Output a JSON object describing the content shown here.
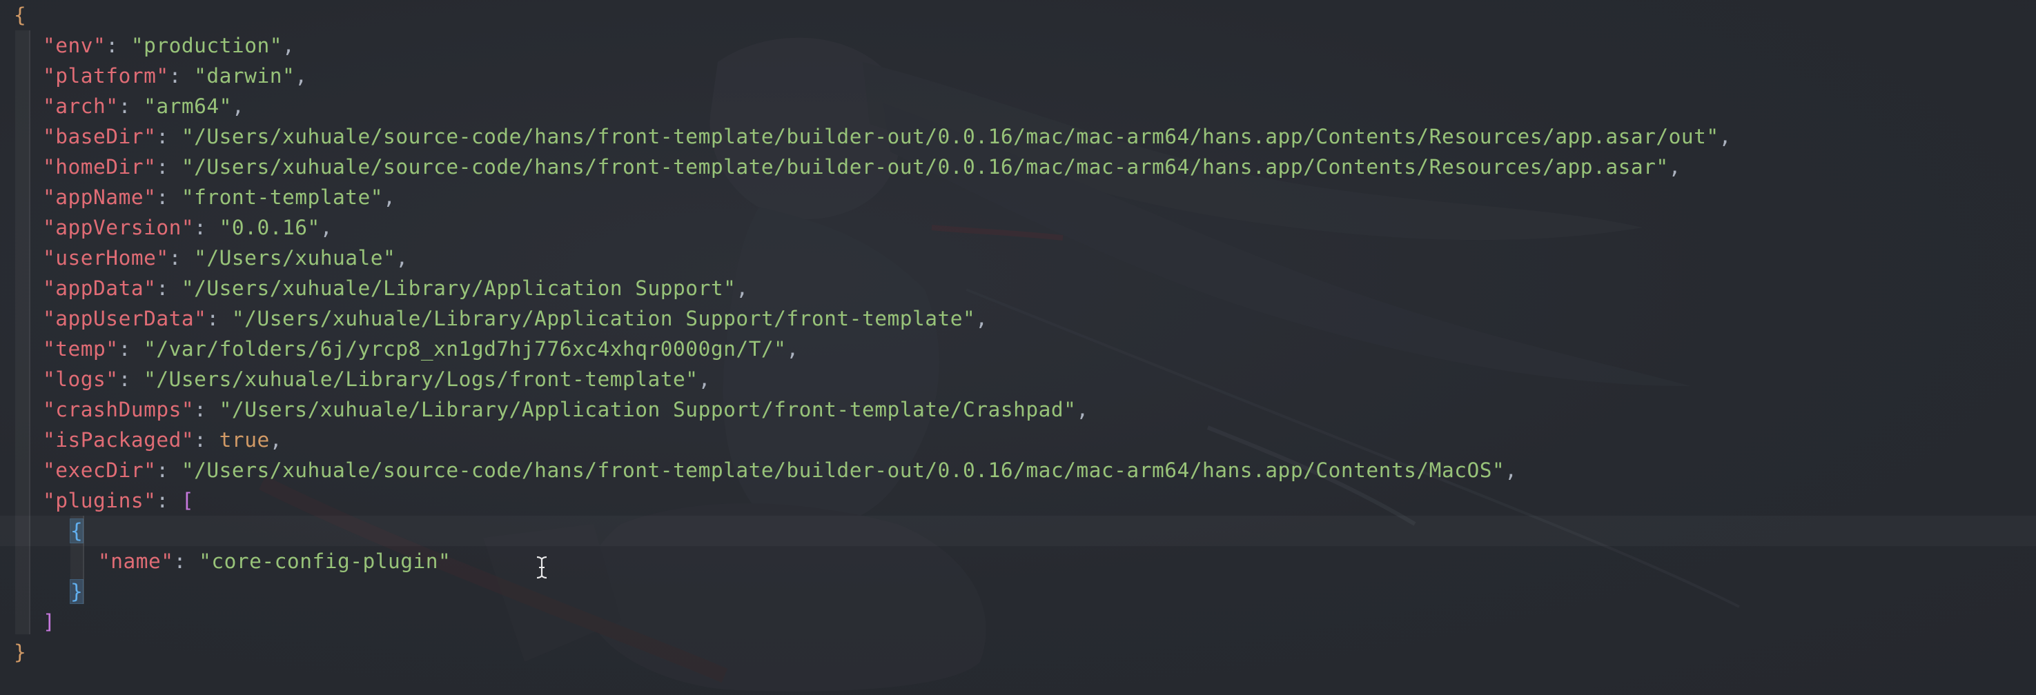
{
  "editor": {
    "open_brace": "{",
    "close_brace": "}",
    "entries": [
      {
        "key": "\"env\"",
        "value": "\"production\"",
        "trail": ","
      },
      {
        "key": "\"platform\"",
        "value": "\"darwin\"",
        "trail": ","
      },
      {
        "key": "\"arch\"",
        "value": "\"arm64\"",
        "trail": ","
      },
      {
        "key": "\"baseDir\"",
        "value": "\"/Users/xuhuale/source-code/hans/front-template/builder-out/0.0.16/mac/mac-arm64/hans.app/Contents/Resources/app.asar/out\"",
        "trail": ","
      },
      {
        "key": "\"homeDir\"",
        "value": "\"/Users/xuhuale/source-code/hans/front-template/builder-out/0.0.16/mac/mac-arm64/hans.app/Contents/Resources/app.asar\"",
        "trail": ","
      },
      {
        "key": "\"appName\"",
        "value": "\"front-template\"",
        "trail": ","
      },
      {
        "key": "\"appVersion\"",
        "value": "\"0.0.16\"",
        "trail": ","
      },
      {
        "key": "\"userHome\"",
        "value": "\"/Users/xuhuale\"",
        "trail": ","
      },
      {
        "key": "\"appData\"",
        "value": "\"/Users/xuhuale/Library/Application Support\"",
        "trail": ","
      },
      {
        "key": "\"appUserData\"",
        "value": "\"/Users/xuhuale/Library/Application Support/front-template\"",
        "trail": ","
      },
      {
        "key": "\"temp\"",
        "value": "\"/var/folders/6j/yrcp8_xn1gd7hj776xc4xhqr0000gn/T/\"",
        "trail": ","
      },
      {
        "key": "\"logs\"",
        "value": "\"/Users/xuhuale/Library/Logs/front-template\"",
        "trail": ","
      },
      {
        "key": "\"crashDumps\"",
        "value": "\"/Users/xuhuale/Library/Application Support/front-template/Crashpad\"",
        "trail": ","
      },
      {
        "key": "\"isPackaged\"",
        "value": "true",
        "trail": ","
      },
      {
        "key": "\"execDir\"",
        "value": "\"/Users/xuhuale/source-code/hans/front-template/builder-out/0.0.16/mac/mac-arm64/hans.app/Contents/MacOS\"",
        "trail": ","
      }
    ],
    "plugins": {
      "key": "\"plugins\"",
      "open_bracket": "[",
      "close_bracket": "]",
      "item_open": "{",
      "item_close": "}",
      "name_key": "\"name\"",
      "name_value": "\"core-config-plugin\""
    },
    "colon": ": ",
    "colors": {
      "key": "#e06c75",
      "string": "#98c379",
      "keyword": "#d19a66",
      "bracket": "#c678dd",
      "matched_brace": "#61afef",
      "background": "#272a30"
    },
    "cursor_icon": "text-cursor-icon"
  }
}
